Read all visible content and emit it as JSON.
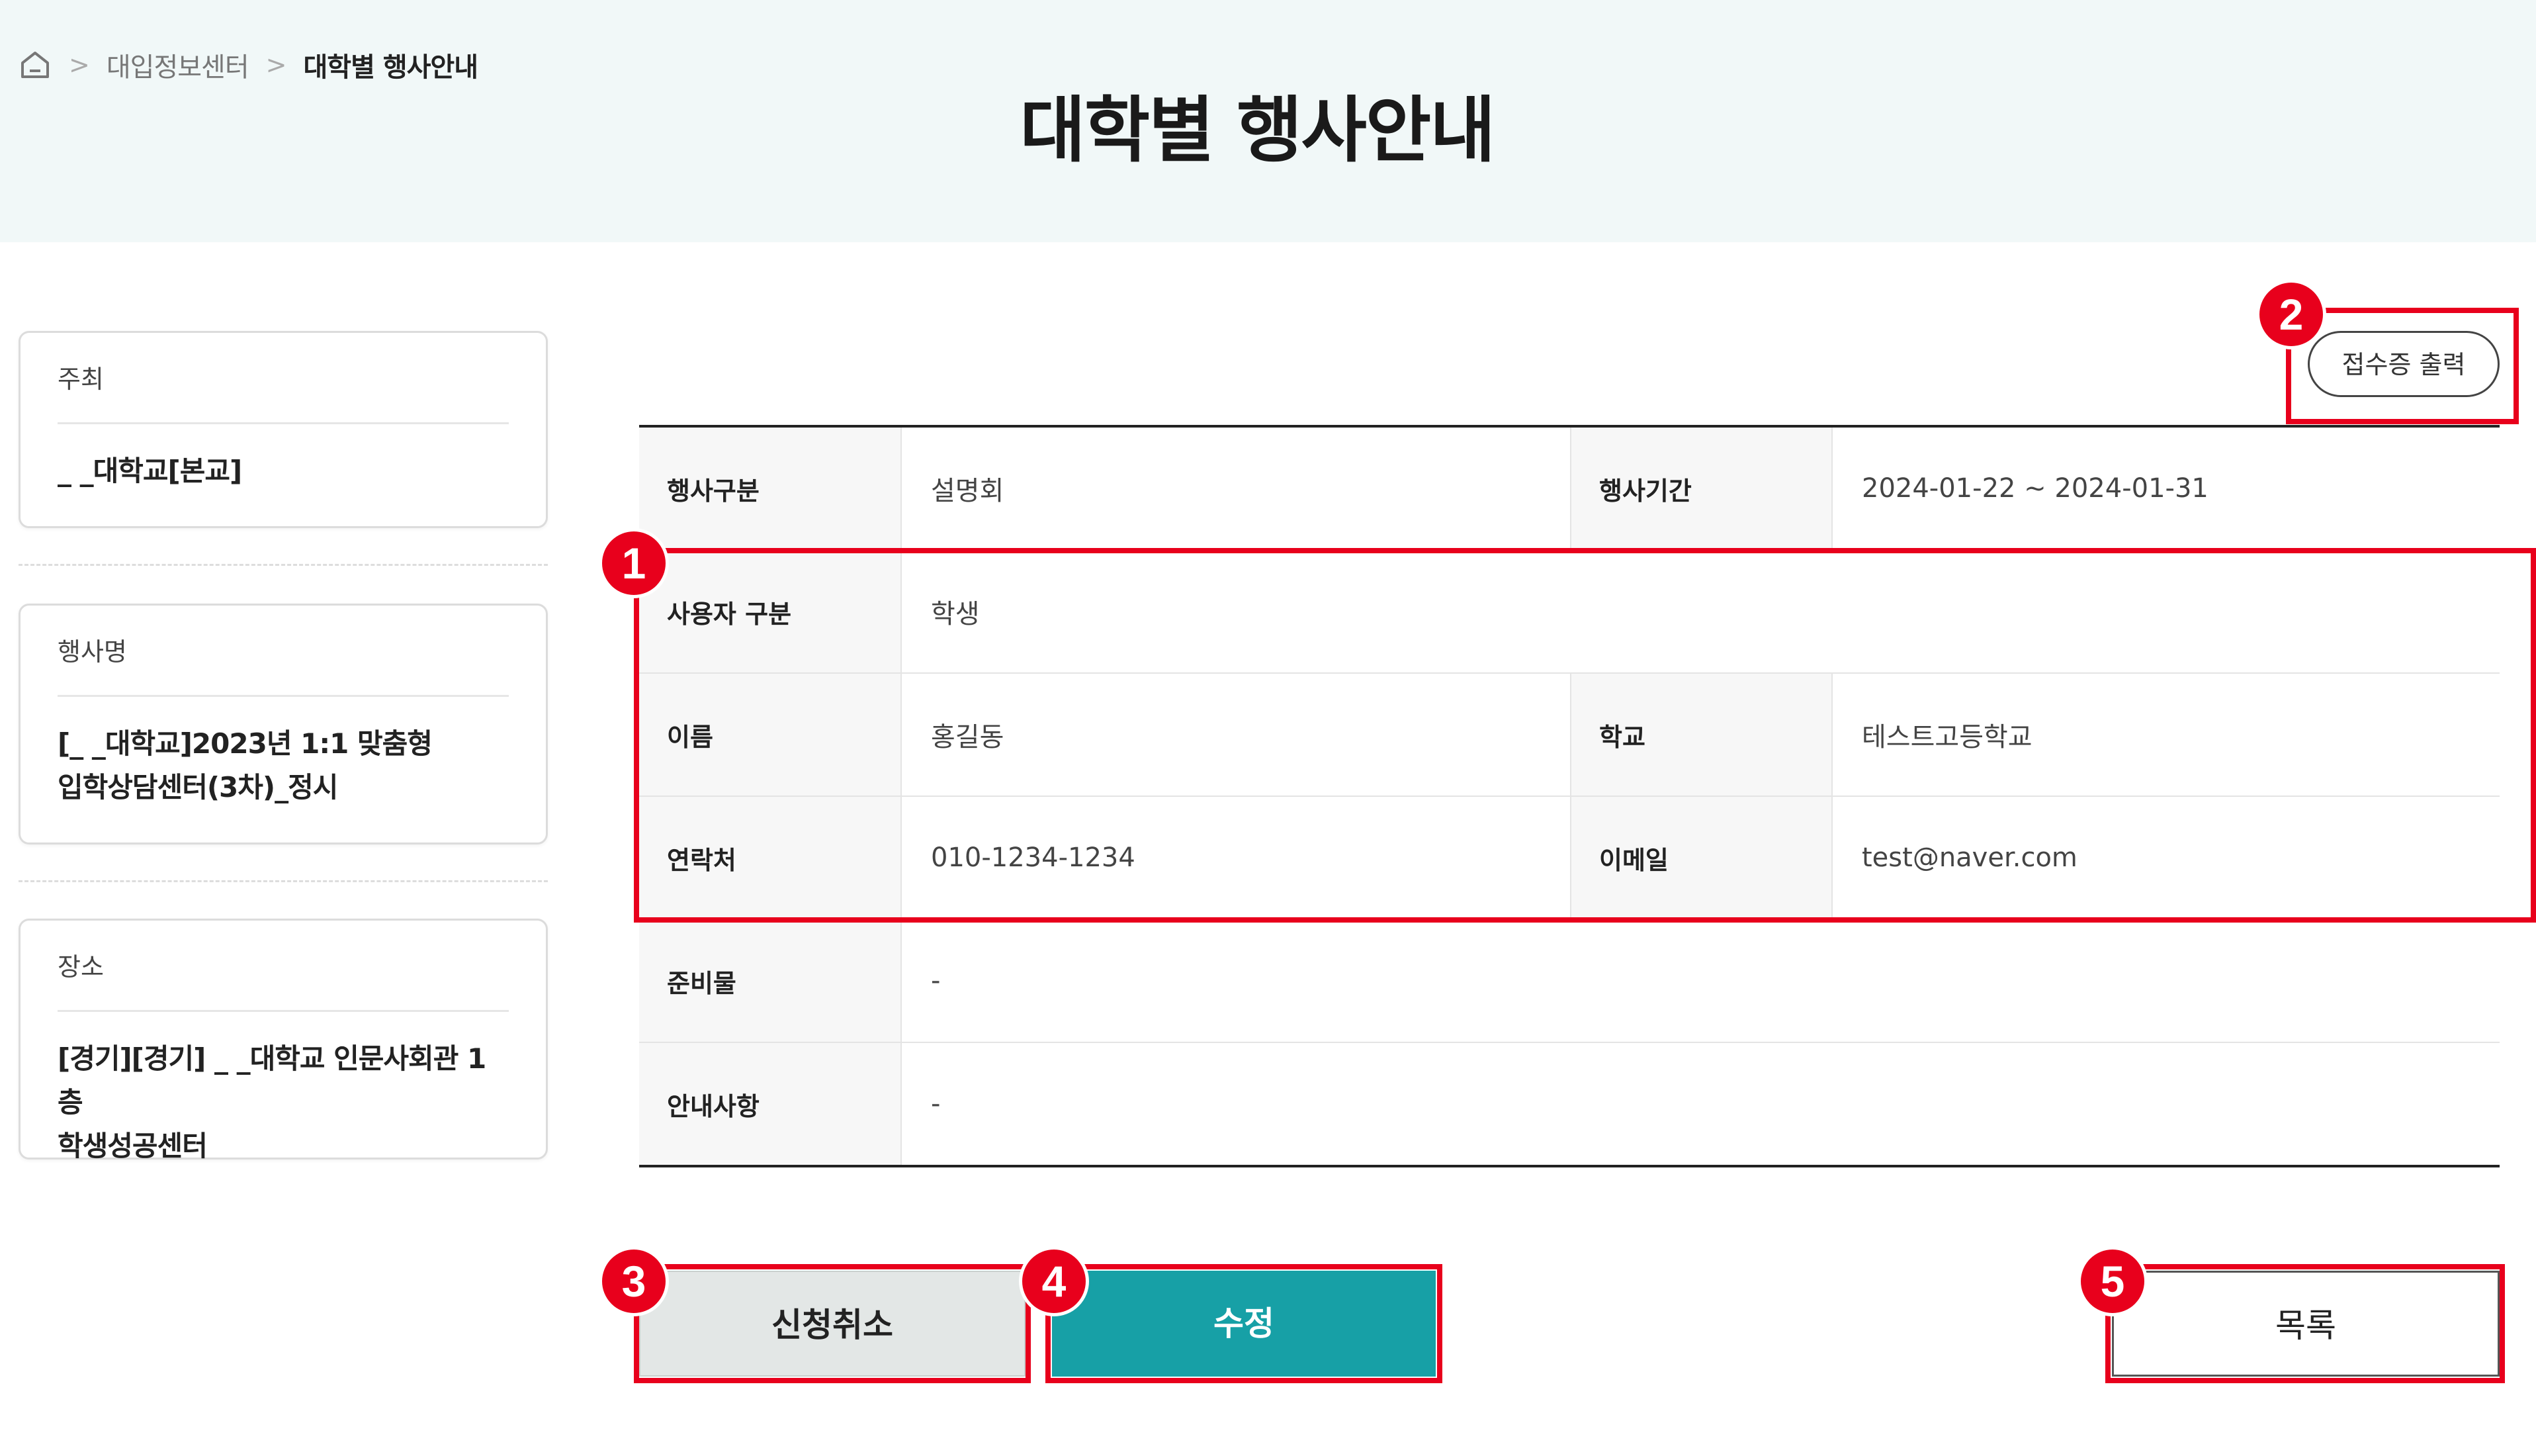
{
  "breadcrumb": {
    "home_icon": "home-icon",
    "level1": "대입정보센터",
    "current": "대학별 행사안내"
  },
  "page_title": "대학별 행사안내",
  "sidebar": {
    "host": {
      "label": "주최",
      "value": "_ _대학교[본교]"
    },
    "event_name": {
      "label": "행사명",
      "value_line1": "[_ _대학교]2023년 1:1 맞춤형",
      "value_line2": "입학상담센터(3차)_정시"
    },
    "place": {
      "label": "장소",
      "value_line1": "[경기][경기] _ _대학교 인문사회관 1층",
      "value_line2": "학생성공센터"
    }
  },
  "receipt_button": "접수증 출력",
  "detail": {
    "event_type_label": "행사구분",
    "event_type_value": "설명회",
    "event_period_label": "행사기간",
    "event_period_value": "2024-01-22 ~ 2024-01-31",
    "user_type_label": "사용자 구분",
    "user_type_value": "학생",
    "name_label": "이름",
    "name_value": "홍길동",
    "school_label": "학교",
    "school_value": "테스트고등학교",
    "contact_label": "연락처",
    "contact_value": "010-1234-1234",
    "email_label": "이메일",
    "email_value": "test@naver.com",
    "prep_label": "준비물",
    "prep_value": "-",
    "notice_label": "안내사항",
    "notice_value": "-"
  },
  "buttons": {
    "cancel": "신청취소",
    "edit": "수정",
    "list": "목록"
  },
  "annotations": {
    "badge1": "1",
    "badge2": "2",
    "badge3": "3",
    "badge4": "4",
    "badge5": "5"
  },
  "colors": {
    "header_bg": "#f1f8f8",
    "accent_teal": "#17a0a6",
    "annotation_red": "#e8001c"
  }
}
